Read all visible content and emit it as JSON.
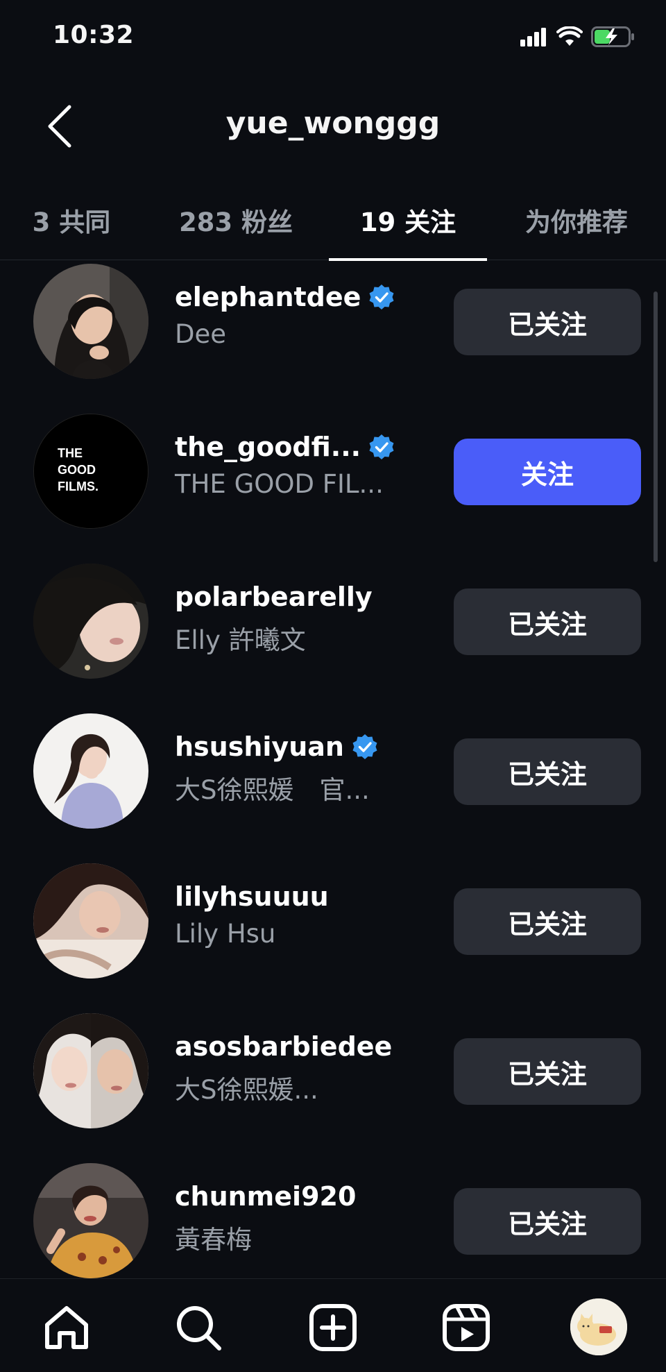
{
  "status_bar": {
    "time": "10:32"
  },
  "header": {
    "title": "yue_wonggg"
  },
  "tabs": [
    {
      "label": "3 共同"
    },
    {
      "label": "283 粉丝"
    },
    {
      "label": "19 关注"
    },
    {
      "label": "为你推荐"
    }
  ],
  "active_tab": "19 关注",
  "accounts": [
    {
      "username": "elephantdee",
      "verified": true,
      "name": "Dee",
      "button": "已关注"
    },
    {
      "username": "the_goodfi...",
      "verified": true,
      "name": "THE GOOD FIL...",
      "button": "关注",
      "avatar_text": "THE GOOD FILMS."
    },
    {
      "username": "polarbearelly",
      "verified": false,
      "name": "Elly 許曦文",
      "button": "已关注"
    },
    {
      "username": "hsushiyuan",
      "verified": true,
      "name": "大S徐熙媛　官...",
      "button": "已关注"
    },
    {
      "username": "lilyhsuuuu",
      "verified": false,
      "name": "Lily Hsu",
      "button": "已关注"
    },
    {
      "username": "asosbarbiedee",
      "verified": false,
      "name": "大S徐熙媛...",
      "button": "已关注"
    },
    {
      "username": "chunmei920",
      "verified": false,
      "name": "黃春梅",
      "button": "已关注"
    }
  ],
  "bottom_nav": [
    "home-icon",
    "search-icon",
    "create-icon",
    "reels-icon",
    "profile-avatar"
  ],
  "colors": {
    "background": "#0b0d12",
    "button_secondary": "#2a2d35",
    "button_primary": "#4a5df9",
    "verified": "#3797f0",
    "muted_text": "#9aa0a8"
  }
}
